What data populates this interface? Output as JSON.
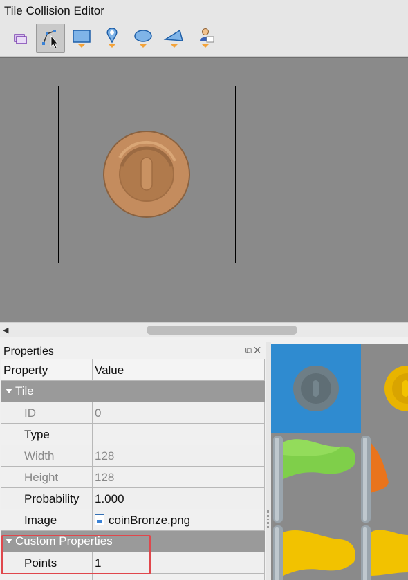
{
  "window": {
    "title": "Tile Collision Editor"
  },
  "toolbar": {
    "tools": [
      {
        "name": "select-objects-tool",
        "icon": "select-objects-icon"
      },
      {
        "name": "edit-polygons-tool",
        "icon": "edit-polygons-icon",
        "active": true
      },
      {
        "name": "insert-rectangle-tool",
        "icon": "rectangle-icon"
      },
      {
        "name": "insert-point-tool",
        "icon": "point-icon"
      },
      {
        "name": "insert-ellipse-tool",
        "icon": "ellipse-icon"
      },
      {
        "name": "insert-polygon-tool",
        "icon": "polygon-icon"
      },
      {
        "name": "insert-template-tool",
        "icon": "template-icon"
      }
    ]
  },
  "canvas": {
    "tile_image": "coin-bronze"
  },
  "properties": {
    "title": "Properties",
    "header": {
      "property": "Property",
      "value": "Value"
    },
    "groups": {
      "tile": "Tile",
      "custom": "Custom Properties"
    },
    "rows": {
      "id": {
        "label": "ID",
        "value": "0"
      },
      "type": {
        "label": "Type",
        "value": ""
      },
      "width": {
        "label": "Width",
        "value": "128"
      },
      "height": {
        "label": "Height",
        "value": "128"
      },
      "probability": {
        "label": "Probability",
        "value": "1.000"
      },
      "image": {
        "label": "Image",
        "value": "coinBronze.png"
      },
      "points": {
        "label": "Points",
        "value": "1"
      }
    }
  },
  "colors": {
    "canvas_bg": "#8a8a8a",
    "selection": "#2f8bd0",
    "highlight": "#e0474c",
    "bronze": "#c48c5e"
  }
}
